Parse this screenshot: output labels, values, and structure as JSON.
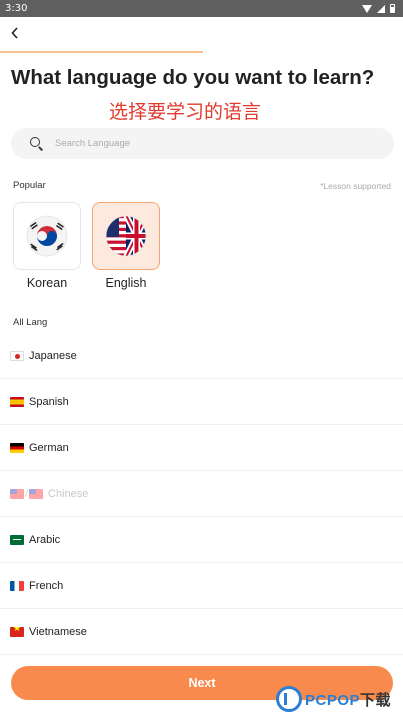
{
  "status_bar": {
    "time": "3:30"
  },
  "header": {
    "title": "What language do you want to learn?",
    "subtitle": "选择要学习的语言",
    "progress_fraction": 0.5
  },
  "search": {
    "placeholder": "Search Language"
  },
  "popular": {
    "label": "Popular",
    "note": "*Lesson supported",
    "items": [
      {
        "name": "Korean",
        "icon": "korea-flag-icon",
        "selected": false
      },
      {
        "name": "English",
        "icon": "us-uk-flag-icon",
        "selected": true
      }
    ]
  },
  "all_langs": {
    "label": "All Lang",
    "items": [
      {
        "name": "Japanese",
        "icon": "japan-flag-icon",
        "disabled": false
      },
      {
        "name": "Spanish",
        "icon": "spain-flag-icon",
        "disabled": false
      },
      {
        "name": "German",
        "icon": "germany-flag-icon",
        "disabled": false
      },
      {
        "name": "Chinese",
        "icon": "china-taiwan-flag-icon",
        "disabled": true
      },
      {
        "name": "Arabic",
        "icon": "saudi-flag-icon",
        "disabled": false
      },
      {
        "name": "French",
        "icon": "france-flag-icon",
        "disabled": false
      },
      {
        "name": "Vietnamese",
        "icon": "vietnam-flag-icon",
        "disabled": false
      }
    ]
  },
  "footer": {
    "next_label": "Next"
  },
  "watermark": {
    "brand": "PCPOP",
    "suffix": "下载"
  },
  "colors": {
    "accent": "#f98a4d",
    "selected_bg": "#fde9dd",
    "subtitle": "#e23a2e"
  }
}
